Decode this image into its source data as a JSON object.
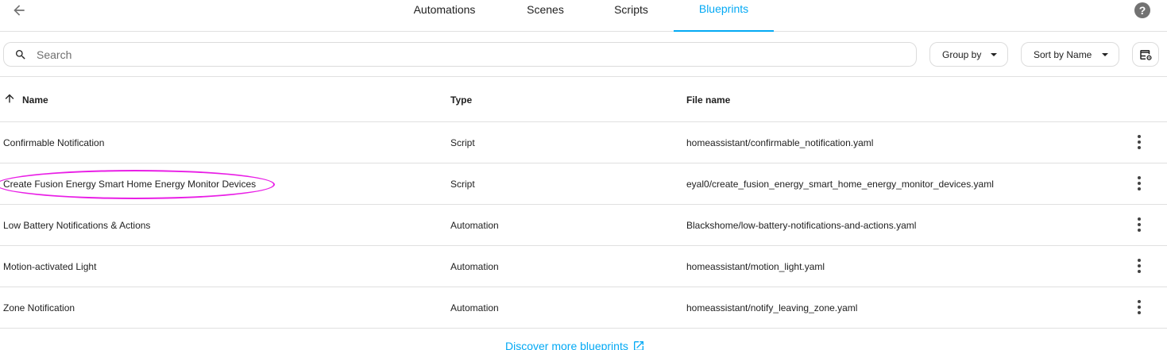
{
  "nav": {
    "tabs": [
      {
        "label": "Automations"
      },
      {
        "label": "Scenes"
      },
      {
        "label": "Scripts"
      },
      {
        "label": "Blueprints",
        "active": true
      }
    ],
    "accent_color": "#03a9f4"
  },
  "toolbar": {
    "search_placeholder": "Search",
    "search_value": "",
    "group_by_label": "Group by",
    "sort_by_label": "Sort by Name"
  },
  "table": {
    "columns": {
      "name": "Name",
      "type": "Type",
      "file": "File name"
    },
    "rows": [
      {
        "name": "Confirmable Notification",
        "type": "Script",
        "file": "homeassistant/confirmable_notification.yaml"
      },
      {
        "name": "Create Fusion Energy Smart Home Energy Monitor Devices",
        "type": "Script",
        "file": "eyal0/create_fusion_energy_smart_home_energy_monitor_devices.yaml"
      },
      {
        "name": "Low Battery Notifications & Actions",
        "type": "Automation",
        "file": "Blackshome/low-battery-notifications-and-actions.yaml"
      },
      {
        "name": "Motion-activated Light",
        "type": "Automation",
        "file": "homeassistant/motion_light.yaml"
      },
      {
        "name": "Zone Notification",
        "type": "Automation",
        "file": "homeassistant/notify_leaving_zone.yaml"
      }
    ]
  },
  "footer": {
    "discover_label": "Discover more blueprints"
  },
  "icons": {
    "back": "arrow-left-icon",
    "help": "help-circle-icon",
    "search": "search-icon",
    "settings": "table-cog-icon",
    "sort": "arrow-up-icon",
    "row_menu": "dots-vertical-icon",
    "external": "open-in-new-icon"
  },
  "annotation_color": "#e91ee6"
}
